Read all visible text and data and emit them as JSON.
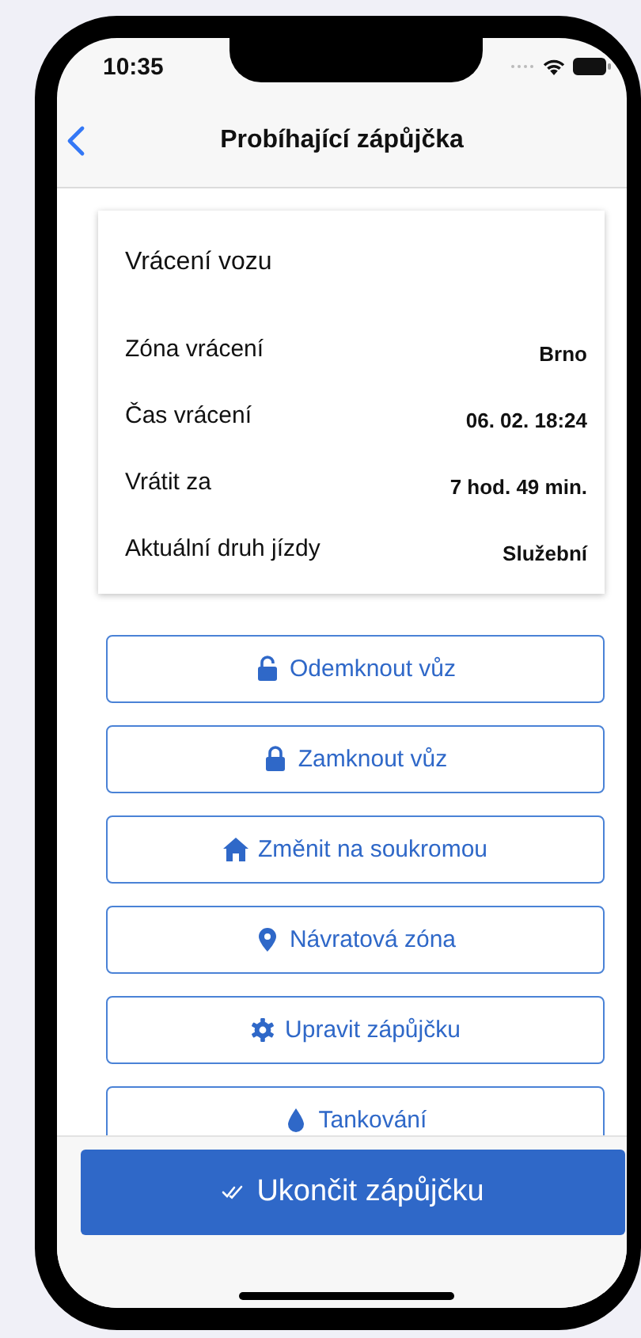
{
  "status_bar": {
    "time": "10:35"
  },
  "nav_bar": {
    "title": "Probíhající zápůjčka"
  },
  "return_card": {
    "title": "Vrácení vozu",
    "rows": [
      {
        "label": "Zóna vrácení",
        "value": "Brno"
      },
      {
        "label": "Čas vrácení",
        "value": "06. 02. 18:24"
      },
      {
        "label": "Vrátit za",
        "value": "7 hod. 49 min."
      },
      {
        "label": "Aktuální druh jízdy",
        "value": "Služební"
      }
    ]
  },
  "actions": [
    {
      "kind": "unlock",
      "label": "Odemknout vůz"
    },
    {
      "kind": "lock",
      "label": "Zamknout vůz"
    },
    {
      "kind": "home",
      "label": "Změnit na soukromou"
    },
    {
      "kind": "pin",
      "label": "Návratová zóna"
    },
    {
      "kind": "gear",
      "label": "Upravit zápůjčku"
    },
    {
      "kind": "drop",
      "label": "Tankování"
    }
  ],
  "footer": {
    "primary_button": {
      "label": "Ukončit zápůjčku"
    }
  }
}
